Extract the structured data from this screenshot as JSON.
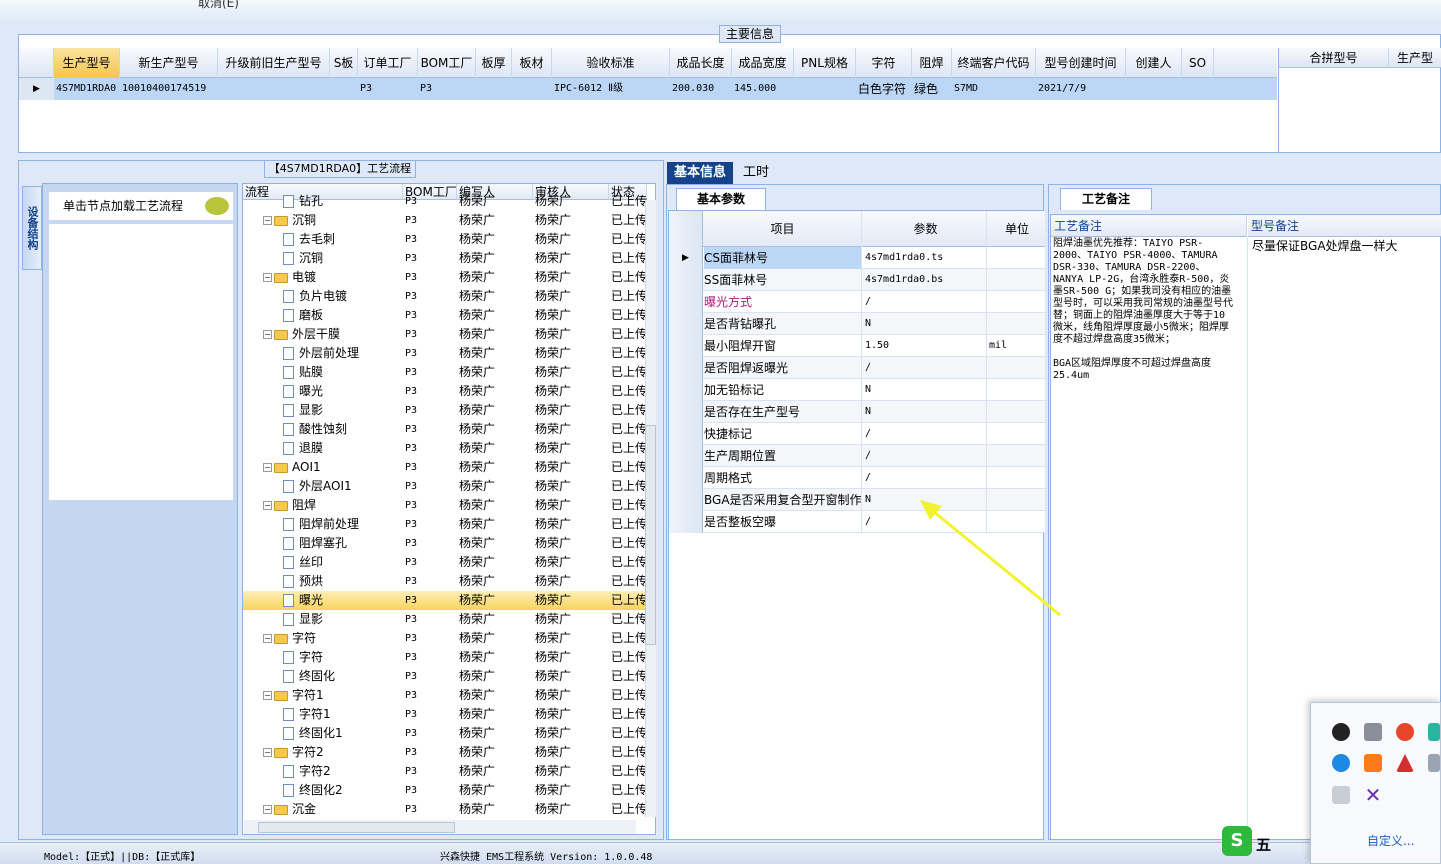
{
  "top": {
    "menu_item": "取消(E)"
  },
  "main": {
    "title": "主要信息",
    "columns": [
      "生产型号",
      "新生产型号",
      "升级前旧生产型号",
      "S板",
      "订单工厂",
      "BOM工厂",
      "板厚",
      "板材",
      "验收标准",
      "成品长度",
      "成品宽度",
      "PNL规格",
      "字符",
      "阻焊",
      "终端客户代码",
      "型号创建时间",
      "创建人",
      "SO"
    ],
    "row": [
      "4S7MD1RDA0",
      "10010400174519",
      "",
      "",
      "P3",
      "P3",
      "",
      "",
      "IPC-6012 Ⅱ级",
      "200.030",
      "145.000",
      "",
      "白色字符",
      "绿色",
      "S7MD",
      "2021/7/9",
      "",
      ""
    ],
    "side_columns": [
      "合拼型号",
      "生产型"
    ]
  },
  "flow": {
    "title": "【4S7MD1RDA0】工艺流程",
    "device_tab": "设备结构",
    "device_hint": "单击节点加载工艺流程",
    "columns": [
      "流程",
      "BOM工厂",
      "编写人",
      "审核人",
      "状态"
    ],
    "rows": [
      {
        "name": "钻孔",
        "lvl": 2,
        "bom": "P3",
        "w": "杨荣广",
        "a": "杨荣广",
        "s": "已上传"
      },
      {
        "name": "沉铜",
        "lvl": 1,
        "bom": "P3",
        "w": "杨荣广",
        "a": "杨荣广",
        "s": "已上传"
      },
      {
        "name": "去毛刺",
        "lvl": 2,
        "bom": "P3",
        "w": "杨荣广",
        "a": "杨荣广",
        "s": "已上传"
      },
      {
        "name": "沉铜",
        "lvl": 2,
        "bom": "P3",
        "w": "杨荣广",
        "a": "杨荣广",
        "s": "已上传"
      },
      {
        "name": "电镀",
        "lvl": 1,
        "bom": "P3",
        "w": "杨荣广",
        "a": "杨荣广",
        "s": "已上传"
      },
      {
        "name": "负片电镀",
        "lvl": 2,
        "bom": "P3",
        "w": "杨荣广",
        "a": "杨荣广",
        "s": "已上传"
      },
      {
        "name": "磨板",
        "lvl": 2,
        "bom": "P3",
        "w": "杨荣广",
        "a": "杨荣广",
        "s": "已上传"
      },
      {
        "name": "外层干膜",
        "lvl": 1,
        "bom": "P3",
        "w": "杨荣广",
        "a": "杨荣广",
        "s": "已上传"
      },
      {
        "name": "外层前处理",
        "lvl": 2,
        "bom": "P3",
        "w": "杨荣广",
        "a": "杨荣广",
        "s": "已上传"
      },
      {
        "name": "贴膜",
        "lvl": 2,
        "bom": "P3",
        "w": "杨荣广",
        "a": "杨荣广",
        "s": "已上传"
      },
      {
        "name": "曝光",
        "lvl": 2,
        "bom": "P3",
        "w": "杨荣广",
        "a": "杨荣广",
        "s": "已上传"
      },
      {
        "name": "显影",
        "lvl": 2,
        "bom": "P3",
        "w": "杨荣广",
        "a": "杨荣广",
        "s": "已上传"
      },
      {
        "name": "酸性蚀刻",
        "lvl": 2,
        "bom": "P3",
        "w": "杨荣广",
        "a": "杨荣广",
        "s": "已上传"
      },
      {
        "name": "退膜",
        "lvl": 2,
        "bom": "P3",
        "w": "杨荣广",
        "a": "杨荣广",
        "s": "已上传"
      },
      {
        "name": "AOI1",
        "lvl": 1,
        "bom": "P3",
        "w": "杨荣广",
        "a": "杨荣广",
        "s": "已上传"
      },
      {
        "name": "外层AOI1",
        "lvl": 2,
        "bom": "P3",
        "w": "杨荣广",
        "a": "杨荣广",
        "s": "已上传"
      },
      {
        "name": "阻焊",
        "lvl": 1,
        "bom": "P3",
        "w": "杨荣广",
        "a": "杨荣广",
        "s": "已上传"
      },
      {
        "name": "阻焊前处理",
        "lvl": 2,
        "bom": "P3",
        "w": "杨荣广",
        "a": "杨荣广",
        "s": "已上传"
      },
      {
        "name": "阻焊塞孔",
        "lvl": 2,
        "bom": "P3",
        "w": "杨荣广",
        "a": "杨荣广",
        "s": "已上传"
      },
      {
        "name": "丝印",
        "lvl": 2,
        "bom": "P3",
        "w": "杨荣广",
        "a": "杨荣广",
        "s": "已上传"
      },
      {
        "name": "预烘",
        "lvl": 2,
        "bom": "P3",
        "w": "杨荣广",
        "a": "杨荣广",
        "s": "已上传"
      },
      {
        "name": "曝光",
        "lvl": 2,
        "bom": "P3",
        "w": "杨荣广",
        "a": "杨荣广",
        "s": "已上传",
        "selected": true
      },
      {
        "name": "显影",
        "lvl": 2,
        "bom": "P3",
        "w": "杨荣广",
        "a": "杨荣广",
        "s": "已上传"
      },
      {
        "name": "字符",
        "lvl": 1,
        "bom": "P3",
        "w": "杨荣广",
        "a": "杨荣广",
        "s": "已上传"
      },
      {
        "name": "字符",
        "lvl": 2,
        "bom": "P3",
        "w": "杨荣广",
        "a": "杨荣广",
        "s": "已上传"
      },
      {
        "name": "终固化",
        "lvl": 2,
        "bom": "P3",
        "w": "杨荣广",
        "a": "杨荣广",
        "s": "已上传"
      },
      {
        "name": "字符1",
        "lvl": 1,
        "bom": "P3",
        "w": "杨荣广",
        "a": "杨荣广",
        "s": "已上传"
      },
      {
        "name": "字符1",
        "lvl": 2,
        "bom": "P3",
        "w": "杨荣广",
        "a": "杨荣广",
        "s": "已上传"
      },
      {
        "name": "终固化1",
        "lvl": 2,
        "bom": "P3",
        "w": "杨荣广",
        "a": "杨荣广",
        "s": "已上传"
      },
      {
        "name": "字符2",
        "lvl": 1,
        "bom": "P3",
        "w": "杨荣广",
        "a": "杨荣广",
        "s": "已上传"
      },
      {
        "name": "字符2",
        "lvl": 2,
        "bom": "P3",
        "w": "杨荣广",
        "a": "杨荣广",
        "s": "已上传"
      },
      {
        "name": "终固化2",
        "lvl": 2,
        "bom": "P3",
        "w": "杨荣广",
        "a": "杨荣广",
        "s": "已上传"
      },
      {
        "name": "沉金",
        "lvl": 1,
        "bom": "P3",
        "w": "杨荣广",
        "a": "杨荣广",
        "s": "已上传"
      }
    ]
  },
  "tabs": {
    "basic": "基本信息",
    "hours": "工时"
  },
  "params": {
    "tab": "基本参数",
    "columns": [
      "项目",
      "参数",
      "单位"
    ],
    "rows": [
      {
        "k": "CS面菲林号",
        "v": "4s7md1rda0.ts",
        "u": "",
        "sel": true
      },
      {
        "k": "SS面菲林号",
        "v": "4s7md1rda0.bs",
        "u": ""
      },
      {
        "k": "曝光方式",
        "v": "/",
        "u": "",
        "pink": true
      },
      {
        "k": "是否背钻曝孔",
        "v": "N",
        "u": ""
      },
      {
        "k": "最小阻焊开窗",
        "v": "1.50",
        "u": "mil"
      },
      {
        "k": "是否阻焊返曝光",
        "v": "/",
        "u": ""
      },
      {
        "k": "加无铅标记",
        "v": "N",
        "u": ""
      },
      {
        "k": "是否存在生产型号",
        "v": "N",
        "u": ""
      },
      {
        "k": "快捷标记",
        "v": "/",
        "u": ""
      },
      {
        "k": "生产周期位置",
        "v": "/",
        "u": ""
      },
      {
        "k": "周期格式",
        "v": "/",
        "u": ""
      },
      {
        "k": "BGA是否采用复合型开窗制作",
        "v": "N",
        "u": ""
      },
      {
        "k": "是否整板空曝",
        "v": "/",
        "u": ""
      }
    ]
  },
  "notes": {
    "tab": "工艺备注",
    "col1": "工艺备注",
    "col2": "型号备注",
    "process_note": "阻焊油墨优先推荐：TAIYO PSR-2000、TAIYO PSR-4000、TAMURA DSR-330、TAMURA DSR-2200、NANYA LP-2G，台湾永胜泰R-500，炎墨SR-500 G；如果我司没有相应的油墨型号时，可以采用我司常规的油墨型号代替；铜面上的阻焊油墨厚度大于等于10微米，线角阻焊厚度最小5微米；阻焊厚度不超过焊盘高度35微米；\n\nBGA区域阻焊厚度不可超过焊盘高度25.4um",
    "model_note": "尽量保证BGA处焊盘一样大"
  },
  "status": {
    "left": "Model:【正式】||DB:【正式库】",
    "center": "兴森快捷 EMS工程系统 Version: 1.0.0.48"
  },
  "tray": {
    "customize": "自定义...",
    "ime": "五"
  },
  "colors": {
    "accent": "#15428b",
    "border": "#8db2e3",
    "selection": "#bcd6f6",
    "highlight": "#f8d45c",
    "arrow": "#f2f230"
  }
}
